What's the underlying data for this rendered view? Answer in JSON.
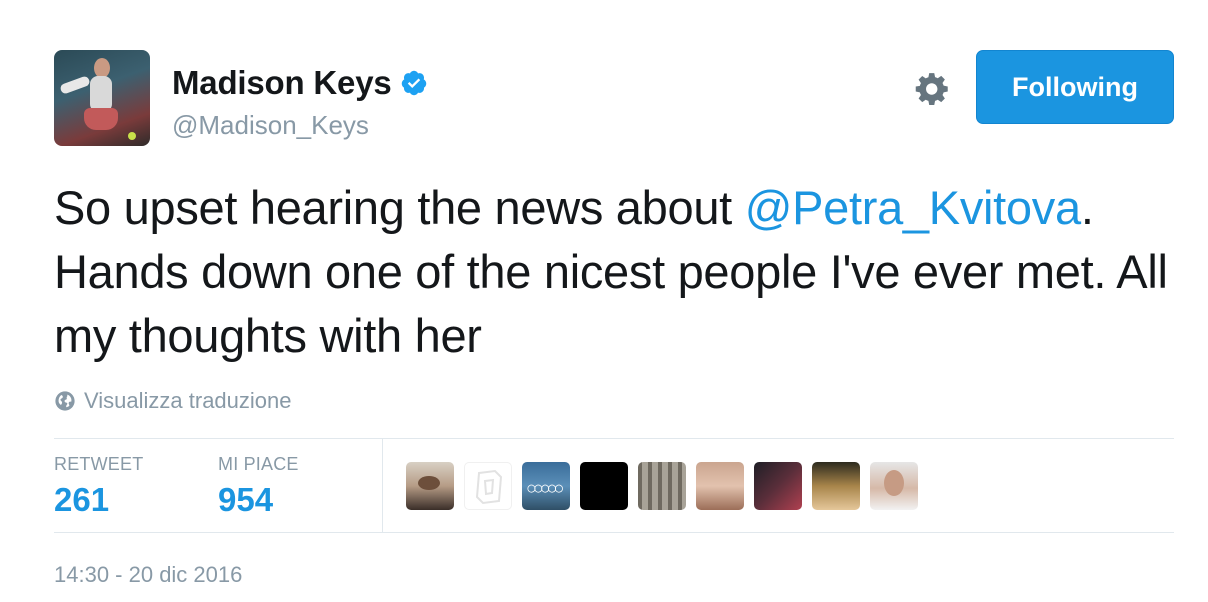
{
  "author": {
    "display_name": "Madison Keys",
    "handle": "@Madison_Keys",
    "verified": true,
    "avatar_icon": "profile-photo"
  },
  "actions": {
    "settings_icon": "gear-icon",
    "follow_label": "Following"
  },
  "tweet": {
    "text_before": "So upset hearing the news about ",
    "mention": "@Petra_Kvitova",
    "text_after": ". Hands down one of the nicest people I've ever met. All my thoughts with her"
  },
  "translate": {
    "icon": "globe-icon",
    "label": "Visualizza traduzione"
  },
  "stats": {
    "retweet_label": "RETWEET",
    "retweet_count": "261",
    "likes_label": "MI PIACE",
    "likes_count": "954"
  },
  "timestamp": "14:30 - 20 dic 2016",
  "colors": {
    "accent": "#1b95e0",
    "muted": "#8899a6",
    "text": "#14171a",
    "divider": "#e1e8ed"
  }
}
